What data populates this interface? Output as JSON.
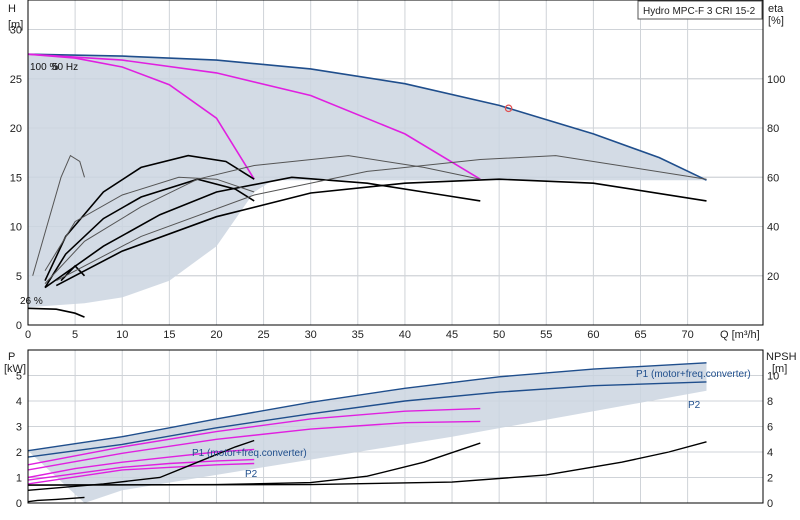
{
  "chart_data": [
    {
      "type": "line",
      "panel": "head-efficiency",
      "title_box": "Hydro MPC-F 3 CRI 15-2",
      "left_axis": {
        "label": "H",
        "unit": "[m]",
        "ticks": [
          0,
          5,
          10,
          15,
          20,
          25,
          30
        ],
        "range": [
          0,
          33
        ]
      },
      "right_axis": {
        "label": "eta",
        "unit": "[%]",
        "ticks": [
          20,
          40,
          60,
          80,
          100
        ],
        "range": [
          0,
          132
        ]
      },
      "x_axis": {
        "label": "Q [m³/h]",
        "ticks": [
          0,
          5,
          10,
          15,
          20,
          25,
          30,
          35,
          40,
          45,
          50,
          55,
          60,
          65,
          70
        ],
        "range": [
          0,
          78
        ]
      },
      "grid": true,
      "annotations": [
        "100 %",
        "50 Hz",
        "26 %"
      ],
      "operating_point": {
        "q": 51,
        "h": 22
      },
      "envelope_upper": [
        [
          0,
          27.5
        ],
        [
          10,
          27.3
        ],
        [
          20,
          26.9
        ],
        [
          30,
          26
        ],
        [
          40,
          24.5
        ],
        [
          50,
          22.3
        ],
        [
          60,
          19.4
        ],
        [
          67,
          17
        ],
        [
          72,
          14.7
        ]
      ],
      "envelope_lower_right": [
        [
          72,
          14.7
        ],
        [
          26,
          14.7
        ],
        [
          24,
          13.5
        ],
        [
          20,
          8
        ],
        [
          15,
          4.5
        ],
        [
          10,
          2.8
        ],
        [
          6,
          2.2
        ],
        [
          0,
          1.8
        ]
      ],
      "series": [
        {
          "color": "#1f4e8c",
          "style": "outline",
          "values": [
            [
              0,
              27.5
            ],
            [
              10,
              27.3
            ],
            [
              20,
              26.9
            ],
            [
              30,
              26
            ],
            [
              40,
              24.5
            ],
            [
              50,
              22.3
            ],
            [
              60,
              19.4
            ],
            [
              67,
              17
            ],
            [
              72,
              14.7
            ]
          ]
        },
        {
          "color": "#e020e0",
          "values": [
            [
              0,
              27.5
            ],
            [
              5,
              27.1
            ],
            [
              10,
              26.2
            ],
            [
              15,
              24.4
            ],
            [
              20,
              21
            ],
            [
              24,
              14.8
            ]
          ]
        },
        {
          "color": "#e020e0",
          "values": [
            [
              0,
              27.5
            ],
            [
              10,
              26.9
            ],
            [
              20,
              25.6
            ],
            [
              30,
              23.3
            ],
            [
              40,
              19.4
            ],
            [
              48,
              14.8
            ]
          ]
        },
        {
          "color": "#000000",
          "values": [
            [
              1.8,
              4.5
            ],
            [
              4,
              9
            ],
            [
              8,
              13.5
            ],
            [
              12,
              16
            ],
            [
              17,
              17.2
            ],
            [
              21,
              16.6
            ],
            [
              24,
              14.8
            ]
          ]
        },
        {
          "color": "#000000",
          "values": [
            [
              1.8,
              3.8
            ],
            [
              4,
              7.2
            ],
            [
              8,
              10.8
            ],
            [
              12,
              13
            ],
            [
              18,
              14.8
            ],
            [
              22,
              13.8
            ],
            [
              24,
              12.6
            ]
          ]
        },
        {
          "color": "#000000",
          "values": [
            [
              1.8,
              3.8
            ],
            [
              8,
              8
            ],
            [
              14,
              11.2
            ],
            [
              20,
              13.5
            ],
            [
              28,
              15
            ],
            [
              36,
              14.4
            ],
            [
              44,
              13.2
            ],
            [
              48,
              12.6
            ]
          ]
        },
        {
          "color": "#000000",
          "values": [
            [
              3,
              4
            ],
            [
              10,
              7.5
            ],
            [
              20,
              11
            ],
            [
              30,
              13.4
            ],
            [
              40,
              14.4
            ],
            [
              50,
              14.8
            ],
            [
              60,
              14.4
            ],
            [
              72,
              12.6
            ]
          ]
        },
        {
          "color": "#000000",
          "values": [
            [
              3.5,
              4.5
            ],
            [
              5,
              6
            ],
            [
              6,
              5
            ]
          ]
        },
        {
          "color": "#555555",
          "values": [
            [
              0.5,
              5
            ],
            [
              2,
              10
            ],
            [
              3.5,
              15
            ],
            [
              4.5,
              17.2
            ],
            [
              5.5,
              16.6
            ],
            [
              6,
              15
            ]
          ]
        },
        {
          "color": "#555555",
          "values": [
            [
              1.8,
              5.5
            ],
            [
              5,
              10.5
            ],
            [
              10,
              13.2
            ],
            [
              16,
              15
            ],
            [
              20,
              14.8
            ],
            [
              24,
              13.5
            ]
          ]
        },
        {
          "color": "#555555",
          "values": [
            [
              1.8,
              4.2
            ],
            [
              6,
              8.5
            ],
            [
              12,
              12
            ],
            [
              18,
              14.8
            ],
            [
              24,
              16.2
            ],
            [
              34,
              17.2
            ],
            [
              42,
              16
            ],
            [
              48,
              14.8
            ]
          ]
        },
        {
          "color": "#555555",
          "values": [
            [
              3,
              4.5
            ],
            [
              12,
              9
            ],
            [
              24,
              13.2
            ],
            [
              36,
              15.6
            ],
            [
              48,
              16.8
            ],
            [
              56,
              17.2
            ],
            [
              64,
              16
            ],
            [
              72,
              14.8
            ]
          ]
        },
        {
          "color": "#000000",
          "values": [
            [
              0,
              1.7
            ],
            [
              3,
              1.6
            ],
            [
              5,
              1.2
            ],
            [
              6,
              0.8
            ]
          ]
        }
      ]
    },
    {
      "type": "line",
      "panel": "power-npsh",
      "left_axis": {
        "label": "P",
        "unit": "[kW]",
        "ticks": [
          0,
          1,
          2,
          3,
          4,
          5
        ],
        "range": [
          0,
          6
        ]
      },
      "right_axis": {
        "label": "NPSH",
        "unit": "[m]",
        "ticks": [
          0,
          2,
          4,
          6,
          8,
          10
        ],
        "range": [
          0,
          12
        ]
      },
      "grid": true,
      "annotations": [
        "P1 (motor+freq.converter)",
        "P2",
        "P1 (motor+freq.converter)",
        "P2"
      ],
      "series": [
        {
          "color": "#1f4e8c",
          "values": [
            [
              0,
              2.05
            ],
            [
              10,
              2.6
            ],
            [
              20,
              3.3
            ],
            [
              30,
              3.95
            ],
            [
              40,
              4.5
            ],
            [
              50,
              4.95
            ],
            [
              60,
              5.25
            ],
            [
              72,
              5.5
            ]
          ]
        },
        {
          "color": "#1f4e8c",
          "values": [
            [
              0,
              1.8
            ],
            [
              10,
              2.3
            ],
            [
              20,
              2.95
            ],
            [
              30,
              3.5
            ],
            [
              40,
              4
            ],
            [
              50,
              4.35
            ],
            [
              60,
              4.6
            ],
            [
              72,
              4.75
            ]
          ]
        },
        {
          "color": "#e020e0",
          "values": [
            [
              0,
              1.5
            ],
            [
              10,
              2.2
            ],
            [
              20,
              2.8
            ],
            [
              30,
              3.3
            ],
            [
              40,
              3.6
            ],
            [
              48,
              3.7
            ]
          ]
        },
        {
          "color": "#e020e0",
          "values": [
            [
              0,
              1.3
            ],
            [
              10,
              1.95
            ],
            [
              20,
              2.5
            ],
            [
              30,
              2.9
            ],
            [
              40,
              3.15
            ],
            [
              48,
              3.2
            ]
          ]
        },
        {
          "color": "#e020e0",
          "values": [
            [
              0,
              1
            ],
            [
              5,
              1.35
            ],
            [
              10,
              1.6
            ],
            [
              15,
              1.8
            ],
            [
              20,
              2
            ],
            [
              24,
              2.1
            ]
          ]
        },
        {
          "color": "#e020e0",
          "values": [
            [
              0,
              0.9
            ],
            [
              5,
              1.15
            ],
            [
              10,
              1.4
            ],
            [
              15,
              1.55
            ],
            [
              20,
              1.65
            ],
            [
              24,
              1.7
            ]
          ]
        },
        {
          "color": "#e020e0",
          "values": [
            [
              0,
              0.75
            ],
            [
              10,
              1.3
            ],
            [
              20,
              1.5
            ],
            [
              24,
              1.55
            ]
          ]
        },
        {
          "color": "#000000",
          "values": [
            [
              0,
              0.05
            ],
            [
              1,
              0.1
            ],
            [
              3,
              0.14
            ],
            [
              6,
              0.22
            ]
          ]
        },
        {
          "color": "#000000",
          "values": [
            [
              0,
              0.5
            ],
            [
              8,
              0.75
            ],
            [
              14,
              1
            ],
            [
              18,
              1.6
            ],
            [
              22,
              2.2
            ],
            [
              24,
              2.45
            ]
          ]
        },
        {
          "color": "#000000",
          "values": [
            [
              0,
              0.7
            ],
            [
              20,
              0.72
            ],
            [
              30,
              0.8
            ],
            [
              36,
              1.05
            ],
            [
              42,
              1.6
            ],
            [
              48,
              2.35
            ]
          ]
        },
        {
          "color": "#000000",
          "values": [
            [
              0,
              0.7
            ],
            [
              30,
              0.72
            ],
            [
              45,
              0.82
            ],
            [
              55,
              1.1
            ],
            [
              63,
              1.6
            ],
            [
              68,
              2
            ],
            [
              72,
              2.4
            ]
          ]
        }
      ]
    }
  ]
}
